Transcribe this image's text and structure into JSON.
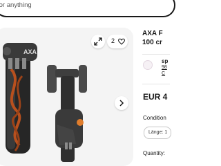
{
  "search": {
    "placeholder": "for anything"
  },
  "gallery": {
    "watch_count": "2",
    "icons": [
      "expand-icon",
      "heart-icon",
      "chevron-right-icon"
    ]
  },
  "listing": {
    "title_line1": "AXA F",
    "title_line2": "100 cr",
    "seller_name": "sp",
    "seller_feedback": "98",
    "seller_contact": "C",
    "price": "EUR 4",
    "condition_label": "Condition",
    "variant_value": "Länge: 1",
    "quantity_label": "Quantity:"
  },
  "colors": {
    "text": "#191919",
    "gallery_bg": "#f4f4f4",
    "accent_orange": "#e07d2c"
  }
}
